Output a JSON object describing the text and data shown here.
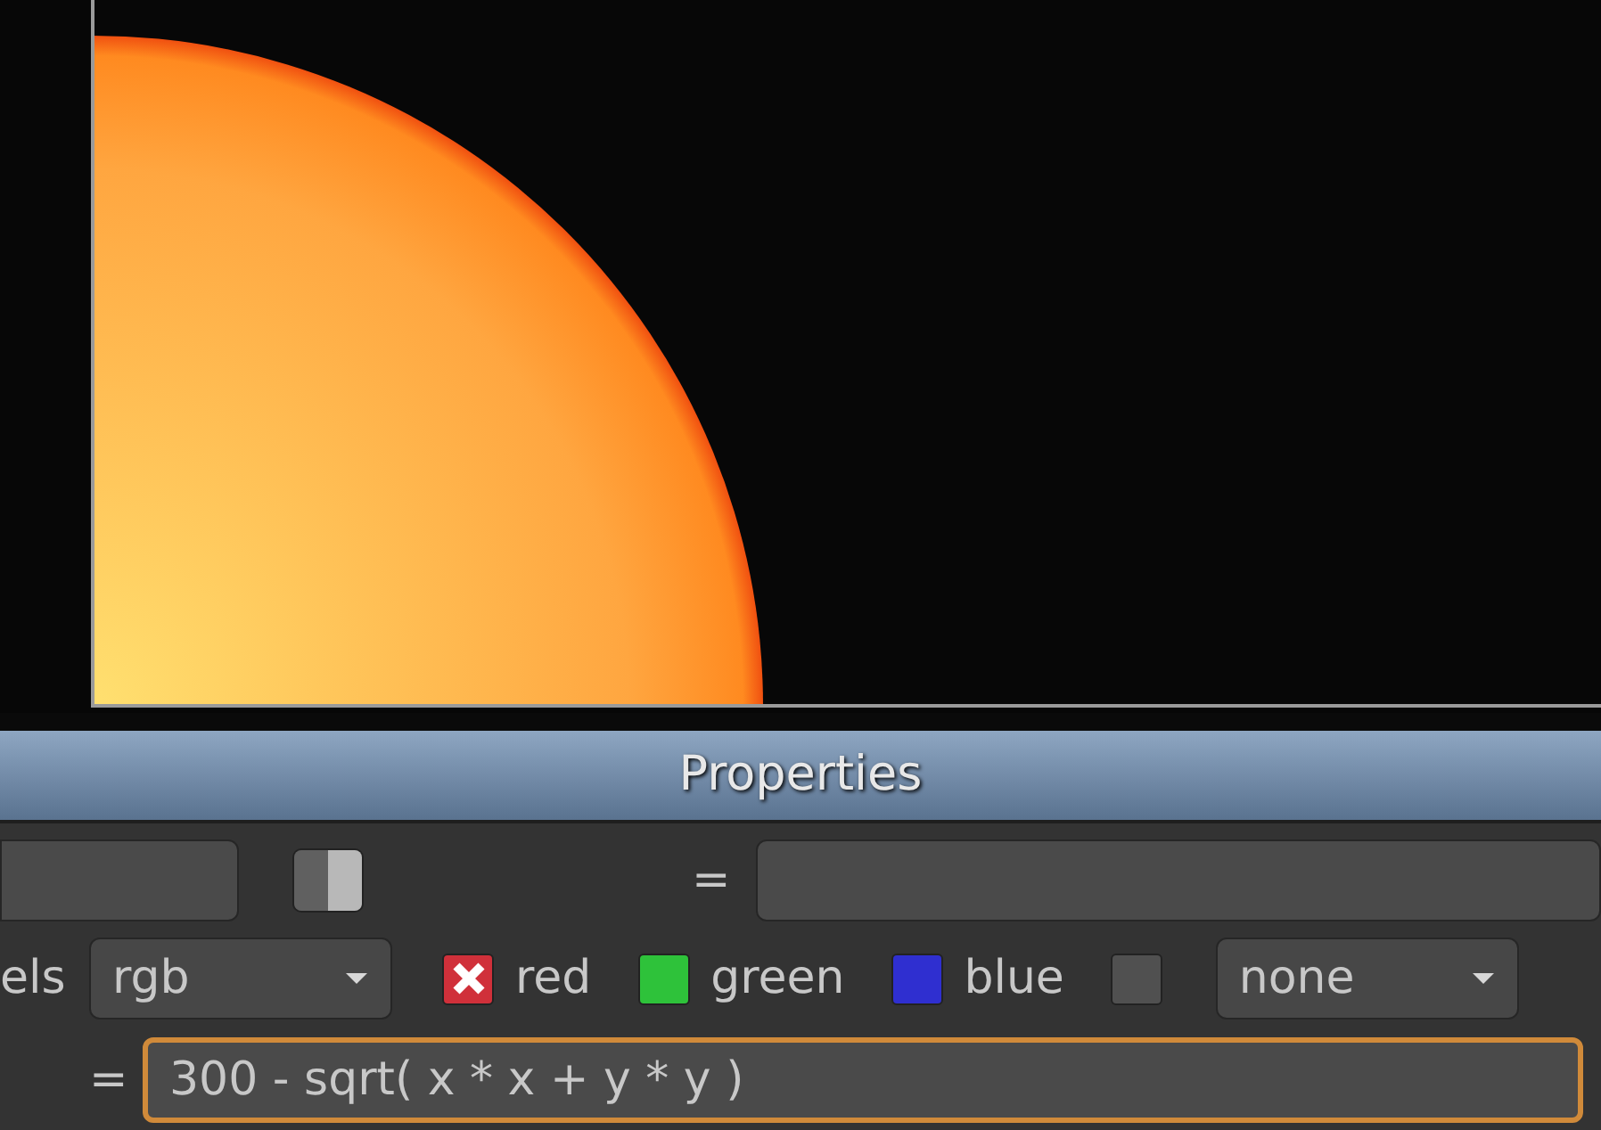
{
  "panel": {
    "title": "Properties"
  },
  "row_1": {
    "equals": "="
  },
  "channels_row": {
    "label": "els",
    "dropdown": "rgb",
    "channels": [
      {
        "label": "red",
        "color": "#d0303a",
        "crossed": true
      },
      {
        "label": "green",
        "color": "#2ec23a",
        "crossed": false
      },
      {
        "label": "blue",
        "color": "#2f2fd0",
        "crossed": false
      },
      {
        "color": "#505050",
        "crossed": false
      }
    ],
    "second_dropdown": "none"
  },
  "expression": {
    "equals": "=",
    "value": "300 - sqrt( x * x + y * y )"
  }
}
